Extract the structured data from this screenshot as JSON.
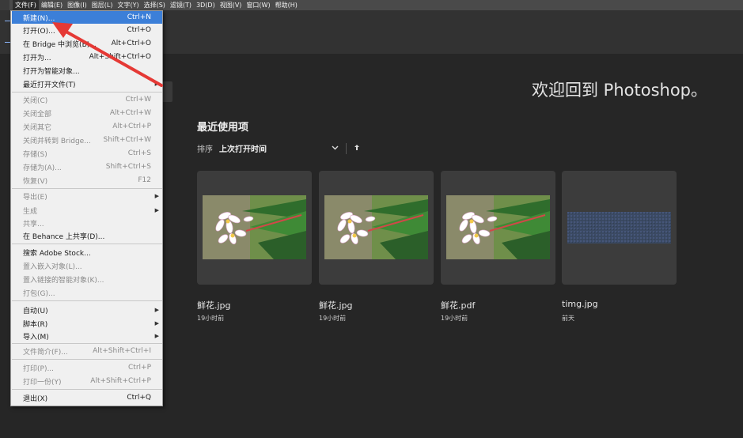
{
  "menubar": {
    "items": [
      "文件(F)",
      "编辑(E)",
      "图像(I)",
      "图层(L)",
      "文字(Y)",
      "选择(S)",
      "滤镜(T)",
      "3D(D)",
      "视图(V)",
      "窗口(W)",
      "帮助(H)"
    ]
  },
  "file_menu": {
    "items": [
      {
        "label": "新建(N)...",
        "shortcut": "Ctrl+N"
      },
      {
        "label": "打开(O)...",
        "shortcut": "Ctrl+O"
      },
      {
        "label": "在 Bridge 中浏览(B)...",
        "shortcut": "Alt+Ctrl+O"
      },
      {
        "label": "打开为...",
        "shortcut": "Alt+Shift+Ctrl+O"
      },
      {
        "label": "打开为智能对象...",
        "shortcut": ""
      },
      {
        "label": "最近打开文件(T)",
        "shortcut": ""
      },
      {
        "label": "关闭(C)",
        "shortcut": "Ctrl+W"
      },
      {
        "label": "关闭全部",
        "shortcut": "Alt+Ctrl+W"
      },
      {
        "label": "关闭其它",
        "shortcut": "Alt+Ctrl+P"
      },
      {
        "label": "关闭并转到 Bridge...",
        "shortcut": "Shift+Ctrl+W"
      },
      {
        "label": "存储(S)",
        "shortcut": "Ctrl+S"
      },
      {
        "label": "存储为(A)...",
        "shortcut": "Shift+Ctrl+S"
      },
      {
        "label": "恢复(V)",
        "shortcut": "F12"
      },
      {
        "label": "导出(E)",
        "shortcut": ""
      },
      {
        "label": "生成",
        "shortcut": ""
      },
      {
        "label": "共享...",
        "shortcut": ""
      },
      {
        "label": "在 Behance 上共享(D)...",
        "shortcut": ""
      },
      {
        "label": "搜索 Adobe Stock...",
        "shortcut": ""
      },
      {
        "label": "置入嵌入对象(L)...",
        "shortcut": ""
      },
      {
        "label": "置入链接的智能对象(K)...",
        "shortcut": ""
      },
      {
        "label": "打包(G)...",
        "shortcut": ""
      },
      {
        "label": "自动(U)",
        "shortcut": ""
      },
      {
        "label": "脚本(R)",
        "shortcut": ""
      },
      {
        "label": "导入(M)",
        "shortcut": ""
      },
      {
        "label": "文件简介(F)...",
        "shortcut": "Alt+Shift+Ctrl+I"
      },
      {
        "label": "打印(P)...",
        "shortcut": "Ctrl+P"
      },
      {
        "label": "打印一份(Y)",
        "shortcut": "Alt+Shift+Ctrl+P"
      },
      {
        "label": "退出(X)",
        "shortcut": "Ctrl+Q"
      }
    ]
  },
  "home": {
    "welcome": "欢迎回到 Photoshop。",
    "recent_title": "最近使用项",
    "sort_label": "排序",
    "sort_value": "上次打开时间",
    "recent_files": [
      {
        "name": "鲜花.jpg",
        "time": "19小时前"
      },
      {
        "name": "鲜花.jpg",
        "time": "19小时前"
      },
      {
        "name": "鲜花.pdf",
        "time": "19小时前"
      },
      {
        "name": "timg.jpg",
        "time": "前天"
      }
    ]
  },
  "icons": {
    "sort_dropdown": "chevron-down-icon",
    "sort_direction": "arrow-up-icon",
    "submenu": "triangle-right-icon"
  },
  "colors": {
    "menu_highlight": "#3c7fd8",
    "annotation_arrow": "#e53935"
  }
}
